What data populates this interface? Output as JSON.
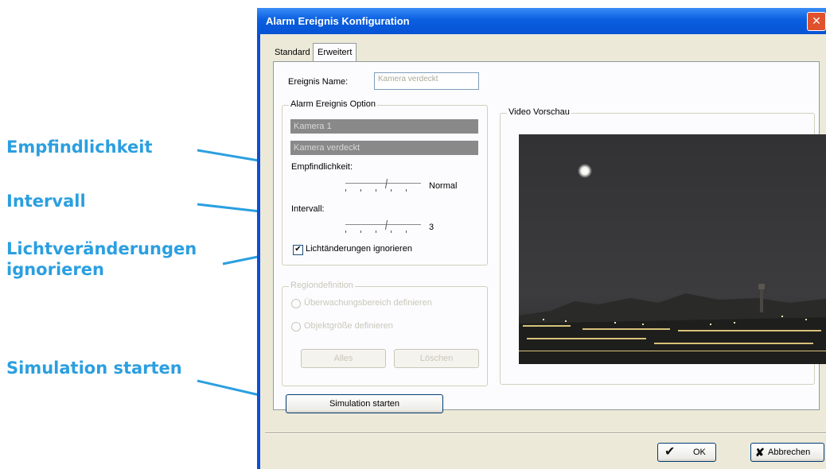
{
  "callouts": {
    "empfindlichkeit": "Empfindlichkeit",
    "intervall": "Intervall",
    "licht_line1": "Lichtveränderungen",
    "licht_line2": "ignorieren",
    "simulation": "Simulation starten"
  },
  "window": {
    "title": "Alarm Ereignis Konfiguration",
    "close": "✕"
  },
  "tabs": [
    {
      "label": "Standard",
      "active": false
    },
    {
      "label": "Erweitert",
      "active": true
    }
  ],
  "event_name": {
    "label": "Ereignis Name:",
    "value": "Kamera verdeckt"
  },
  "alarm_option": {
    "legend": "Alarm Ereignis Option",
    "camera": "Kamera 1",
    "event": "Kamera verdeckt",
    "sensitivity_label": "Empfindlichkeit:",
    "sensitivity_value": "Normal",
    "sensitivity_level": 0.5,
    "interval_label": "Intervall:",
    "interval_value": "3",
    "interval_level": 0.5,
    "ignore_light_label": "Lichtänderungen ignorieren",
    "ignore_light_checked": true,
    "check_glyph": "✔"
  },
  "region": {
    "legend": "Regiondefinition",
    "option1": "Überwachungsbereich definieren",
    "option2": "Objektgröße definieren",
    "all_button": "Alles",
    "delete_button": "Löschen"
  },
  "video": {
    "legend": "Video Vorschau"
  },
  "simulate_button": "Simulation starten",
  "ok_button": "OK",
  "cancel_button": "Abbrechen",
  "colors": {
    "callout": "#2b9fe0",
    "titlebar": "#0a5fe0",
    "dialog_bg": "#ece9d8"
  }
}
